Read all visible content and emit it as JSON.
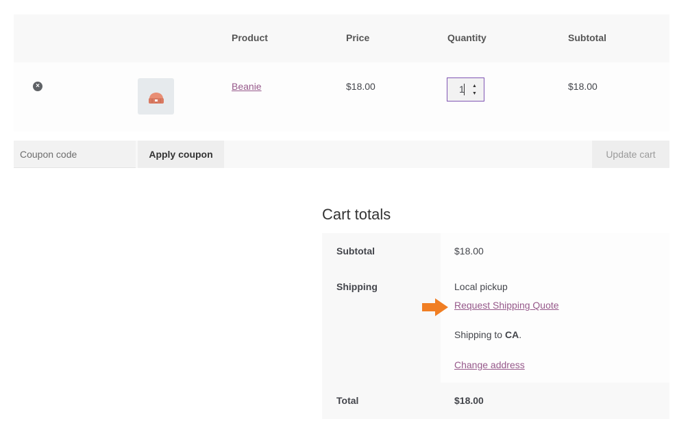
{
  "table": {
    "headers": {
      "product": "Product",
      "price": "Price",
      "quantity": "Quantity",
      "subtotal": "Subtotal"
    },
    "rows": [
      {
        "remove_symbol": "×",
        "thumbnail_icon": "beanie-icon",
        "product": "Beanie",
        "price": "$18.00",
        "quantity": "1",
        "subtotal": "$18.00"
      }
    ]
  },
  "coupon": {
    "placeholder": "Coupon code",
    "apply_label": "Apply coupon"
  },
  "update_label": "Update cart",
  "totals": {
    "title": "Cart totals",
    "subtotal_label": "Subtotal",
    "subtotal_value": "$18.00",
    "shipping_label": "Shipping",
    "shipping_method": "Local pickup",
    "quote_link": "Request Shipping Quote",
    "shipping_to_prefix": "Shipping to",
    "shipping_to_country": "CA",
    "shipping_to_suffix": ".",
    "change_address": "Change address",
    "total_label": "Total",
    "total_value": "$18.00"
  },
  "colors": {
    "link": "#96588a",
    "arrow": "#f07e23",
    "focus_border": "#7f54b3"
  }
}
